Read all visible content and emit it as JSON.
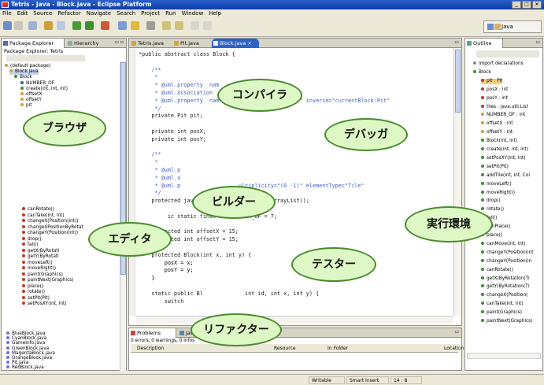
{
  "window": {
    "title": "Tetris - Java - Block.java - Eclipse Platform",
    "controls": [
      "_",
      "□",
      "×"
    ]
  },
  "menu": [
    "File",
    "Edit",
    "Source",
    "Refactor",
    "Navigate",
    "Search",
    "Project",
    "Run",
    "Window",
    "Help"
  ],
  "perspective": {
    "label": "Java"
  },
  "left_panel": {
    "tabs": [
      "Package Explorer",
      "Hierarchy"
    ],
    "subtitle": "Package Explorer: Tetris",
    "tree": [
      "(default package)",
      "Block.java",
      "Block",
      "NUMBER_OF",
      "create(int, int, int)",
      "offsetX",
      "offsetY",
      "pit",
      "canRotate()",
      "canTake(int, int)",
      "changeX(Position(int))",
      "changeXPositionByRotat",
      "changeY(Position(int))",
      "drop()",
      "fall()",
      "getX(ByRotati",
      "getY(ByRotati",
      "moveLeft()",
      "moveRight()",
      "paint(Graphics)",
      "paintNext(Graphics)",
      "place()",
      "rotate()",
      "setPit(Pit)",
      "setPosXY(int, int)",
      "BlueBlock.java",
      "CyanBlock.java",
      "GameInfo.java",
      "GreenBlock.java",
      "MagentaBlock.java",
      "OrangeBlock.java",
      "Pit.java",
      "RedBlock.java"
    ]
  },
  "editor": {
    "tabs": [
      "Tetris.java",
      "Pit.java",
      "Block.java"
    ],
    "code": [
      "*public abstract class Block {",
      "",
      "    /**",
      "     *",
      "     * @uml.property  nam",
      "     * @uml.association",
      "     * @uml.property  nam                    (0 1)\" inverse=\"currentBlock:Pit\"",
      "     */",
      "    private Pit pit;",
      "",
      "    private int posX;",
      "    private int posY;",
      "",
      "    /**",
      "     *",
      "     * @uml.p",
      "     * @uml.a",
      "     * @uml.p                  ultiplicity=\"(0 -1)\" elementType=\"Tile\"",
      "     */",
      "    protected java.util.List tiles = new ArrayList();",
      "",
      "         ic static final int NUMBER_OF = 7;",
      "",
      "    protected int offsetX = 15;",
      "    protected int offsetY = 15;",
      "",
      "    protected Block(int x, int y) {",
      "        posX = x;",
      "        posY = y;",
      "    }",
      "",
      "    static public Bl             int id, int x, int y) {",
      "        switch"
    ]
  },
  "outline": {
    "tab": "Outline",
    "items": [
      "import declarations",
      "Block",
      "pit : Pit",
      "posX : int",
      "posY : int",
      "tiles : java.util.List",
      "NUMBER_OF : int",
      "offsetX : int",
      "offsetY : int",
      "Block(int, int)",
      "create(int, int, int)",
      "setPosXY(int, int)",
      "setPit(Pit)",
      "addTile(int, int, Col",
      "moveLeft()",
      "moveRight()",
      "drop()",
      "rotate()",
      "fall()",
      "canPlace()",
      "place()",
      "canMove(int, int)",
      "changeY(Position(int",
      "changeY(Position(in",
      "canRotate()",
      "getX(ByRotation(Ti",
      "getY(ByRotation(Ti",
      "changeX(Position(",
      "canTake(int, int)",
      "paint(Graphics)",
      "paintNext(Graphics)"
    ]
  },
  "problems": {
    "tabs": [
      "Problems",
      "Javadoc"
    ],
    "summary": "0 errors, 0 warnings, 0 infos",
    "columns": [
      "Description",
      "Resource",
      "In Folder",
      "Location"
    ]
  },
  "status": {
    "mode": "Writable",
    "insert": "Smart Insert",
    "pos": "14 : 8"
  },
  "callouts": [
    "コンパイラ",
    "ブラウザ",
    "デバッガ",
    "ビルダー",
    "実行環境",
    "エディタ",
    "テスター",
    "リファクター"
  ],
  "colors": {
    "callout_fill": "#ddf7c5",
    "callout_border": "#4b8a2e",
    "keyword": "#7f0055",
    "comment": "#3f5fbf",
    "title": "#0a3ca8"
  }
}
